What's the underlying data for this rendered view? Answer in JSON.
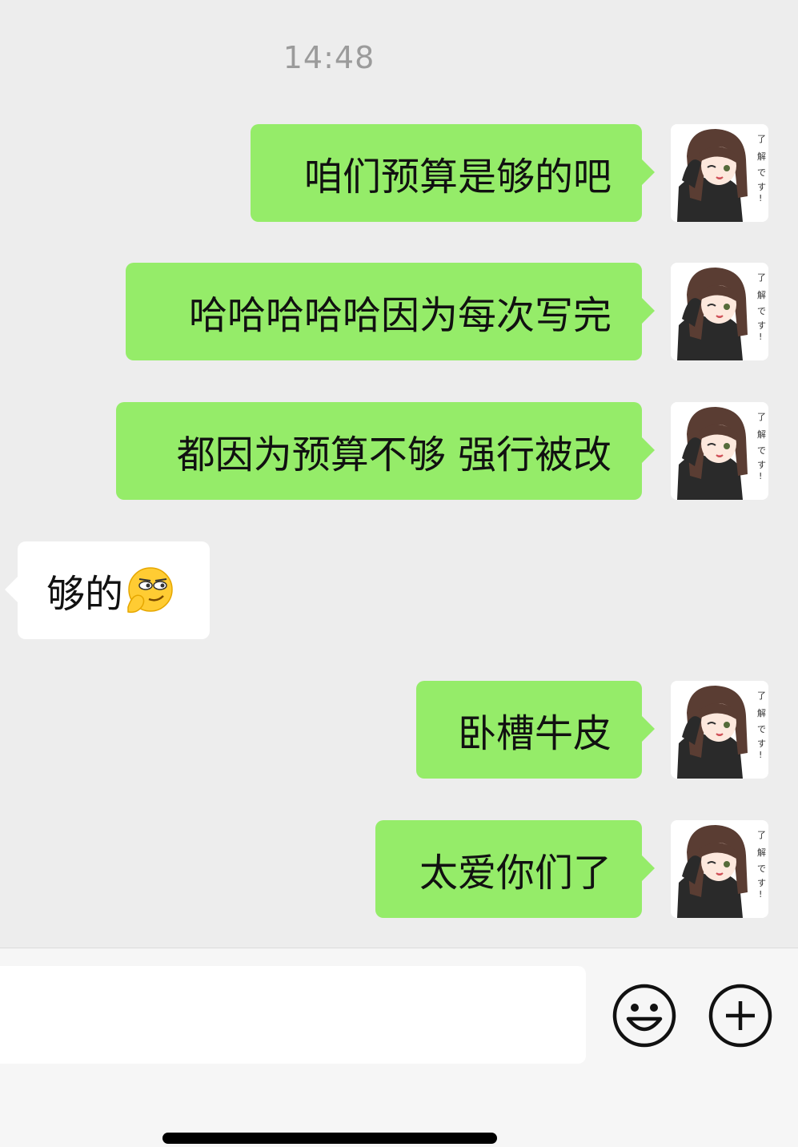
{
  "timestamp": "14:48",
  "messages": [
    {
      "side": "me",
      "text": "咱们预算是够的吧"
    },
    {
      "side": "me",
      "text": "哈哈哈哈哈因为每次写完"
    },
    {
      "side": "me",
      "text": "都因为预算不够 强行被改"
    },
    {
      "side": "them",
      "text": "够的",
      "emoji": "smirk-emoji"
    },
    {
      "side": "me",
      "text": "卧槽牛皮"
    },
    {
      "side": "me",
      "text": "太爱你们了"
    }
  ],
  "avatar_caption": "了解です!",
  "input": {
    "placeholder": "",
    "emoji_button_icon": "smiley-face-icon",
    "more_button_icon": "plus-circle-icon"
  },
  "colors": {
    "background": "#ededed",
    "my_bubble": "#95ec69",
    "their_bubble": "#ffffff",
    "timestamp": "#9b9b9b"
  }
}
